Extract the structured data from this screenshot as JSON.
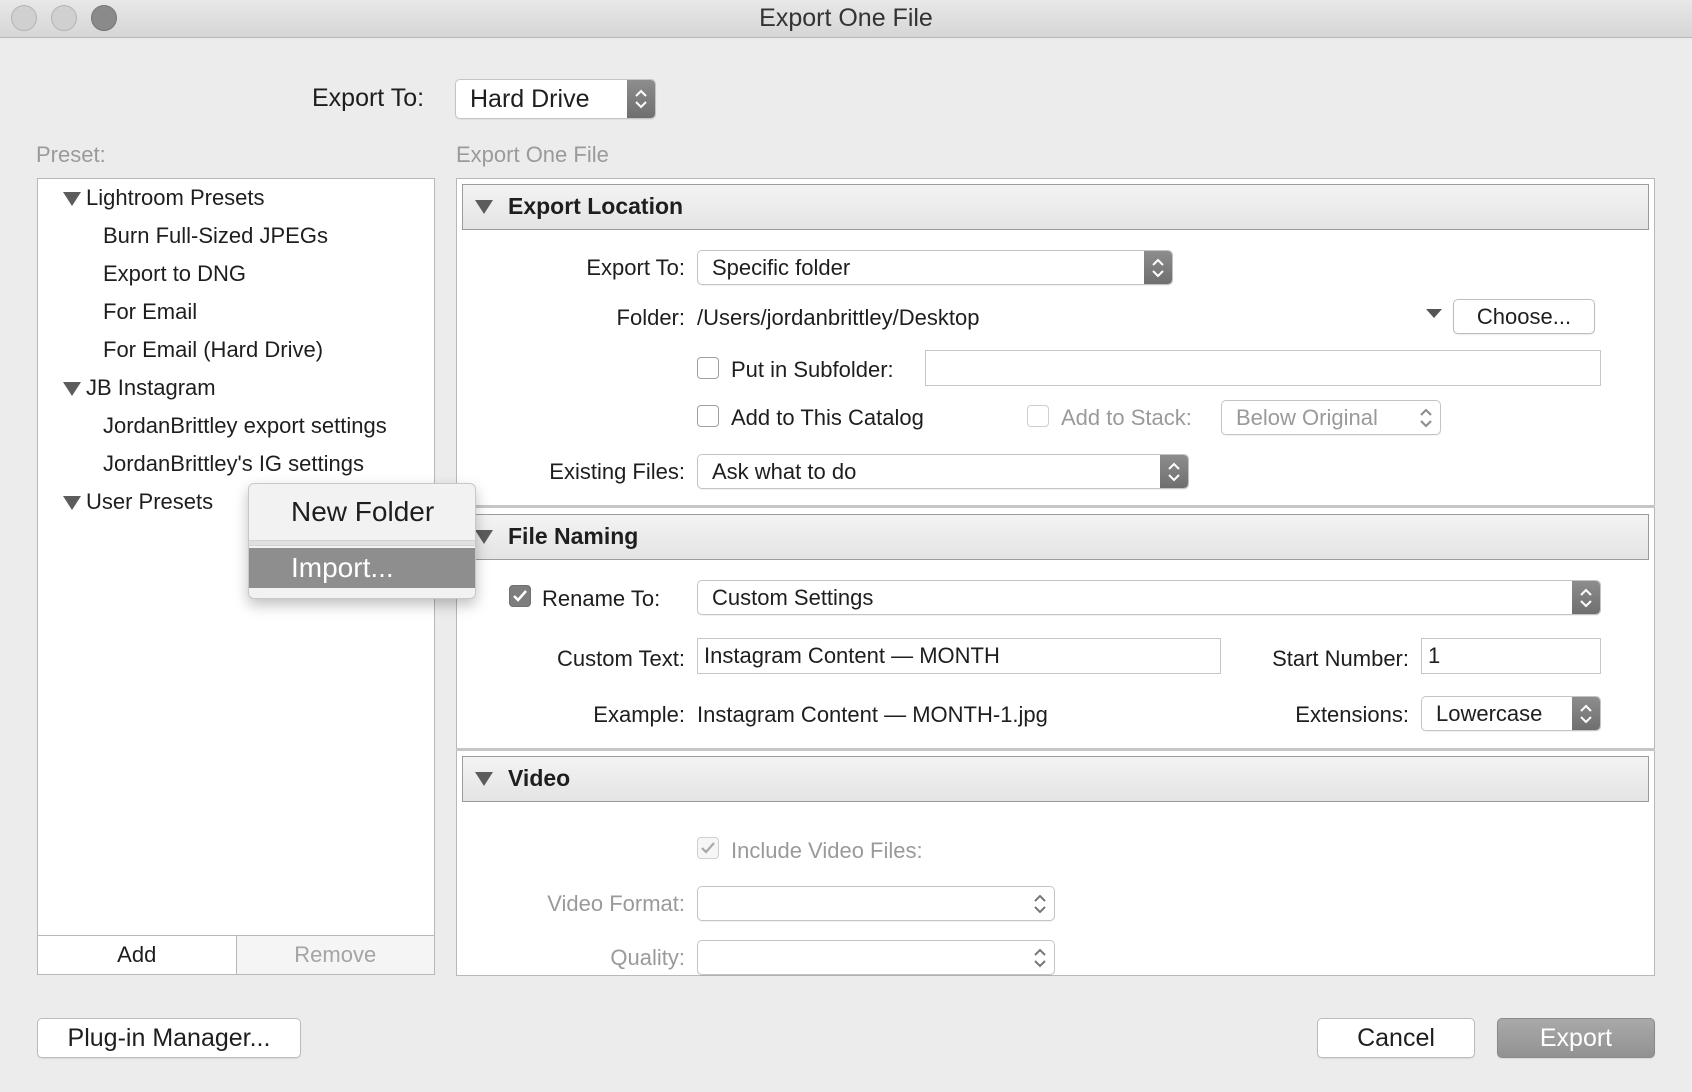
{
  "window": {
    "title": "Export One File"
  },
  "export_to": {
    "label": "Export To:",
    "value": "Hard Drive"
  },
  "preset": {
    "label": "Preset:",
    "groups": [
      {
        "name": "Lightroom Presets",
        "items": [
          "Burn Full-Sized JPEGs",
          "Export to DNG",
          "For Email",
          "For Email (Hard Drive)"
        ]
      },
      {
        "name": "JB Instagram",
        "items": [
          "JordanBrittley export settings",
          "JordanBrittley's IG settings"
        ]
      },
      {
        "name": "User Presets",
        "items": []
      }
    ],
    "add_label": "Add",
    "remove_label": "Remove"
  },
  "context_menu": {
    "new_folder": "New Folder",
    "import": "Import..."
  },
  "panel_title": "Export One File",
  "export_location": {
    "title": "Export Location",
    "export_to_label": "Export To:",
    "export_to_value": "Specific folder",
    "folder_label": "Folder:",
    "folder_value": "/Users/jordanbrittley/Desktop",
    "choose_label": "Choose...",
    "subfolder_label": "Put in Subfolder:",
    "subfolder_value": "",
    "subfolder_checked": false,
    "add_catalog_label": "Add to This Catalog",
    "add_catalog_checked": false,
    "add_stack_label": "Add to Stack:",
    "add_stack_value": "Below Original",
    "existing_files_label": "Existing Files:",
    "existing_files_value": "Ask what to do"
  },
  "file_naming": {
    "title": "File Naming",
    "rename_label": "Rename To:",
    "rename_checked": true,
    "rename_value": "Custom Settings",
    "custom_text_label": "Custom Text:",
    "custom_text_value": "Instagram Content — MONTH",
    "start_number_label": "Start Number:",
    "start_number_value": "1",
    "example_label": "Example:",
    "example_value": "Instagram Content — MONTH-1.jpg",
    "extensions_label": "Extensions:",
    "extensions_value": "Lowercase"
  },
  "video": {
    "title": "Video",
    "include_label": "Include Video Files:",
    "include_checked": true,
    "format_label": "Video Format:",
    "format_value": "",
    "quality_label": "Quality:",
    "quality_value": ""
  },
  "footer": {
    "plugin_manager": "Plug-in Manager...",
    "cancel": "Cancel",
    "export": "Export"
  }
}
